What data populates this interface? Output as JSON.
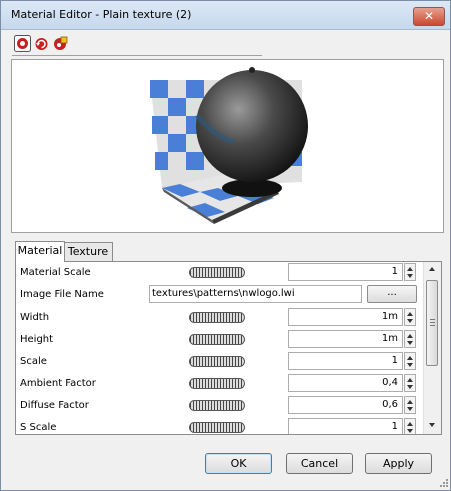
{
  "window": {
    "title": "Material Editor - Plain texture (2)",
    "close_glyph": "✕"
  },
  "toolbar": {
    "icons": [
      "render-icon",
      "reset-icon",
      "material-library-icon"
    ],
    "accent_color": "#c82020"
  },
  "preview": {
    "background": "#ffffff",
    "checker_colors": [
      "#4a7fd8",
      "#e0e0e0"
    ],
    "sphere_color": "#3a3a3a"
  },
  "tabs": [
    {
      "label": "Material",
      "active": true
    },
    {
      "label": "Texture",
      "active": false
    }
  ],
  "properties": [
    {
      "label": "Material Scale",
      "type": "number",
      "value": "1"
    },
    {
      "label": "Image File Name",
      "type": "file",
      "value": "textures\\patterns\\nwlogo.lwi",
      "button": "..."
    },
    {
      "label": "Width",
      "type": "number",
      "value": "1m"
    },
    {
      "label": "Height",
      "type": "number",
      "value": "1m"
    },
    {
      "label": "Scale",
      "type": "number",
      "value": "1"
    },
    {
      "label": "Ambient Factor",
      "type": "number",
      "value": "0,4"
    },
    {
      "label": "Diffuse Factor",
      "type": "number",
      "value": "0,6"
    },
    {
      "label": "S Scale",
      "type": "number",
      "value": "1"
    }
  ],
  "buttons": {
    "ok": "OK",
    "cancel": "Cancel",
    "apply": "Apply"
  }
}
